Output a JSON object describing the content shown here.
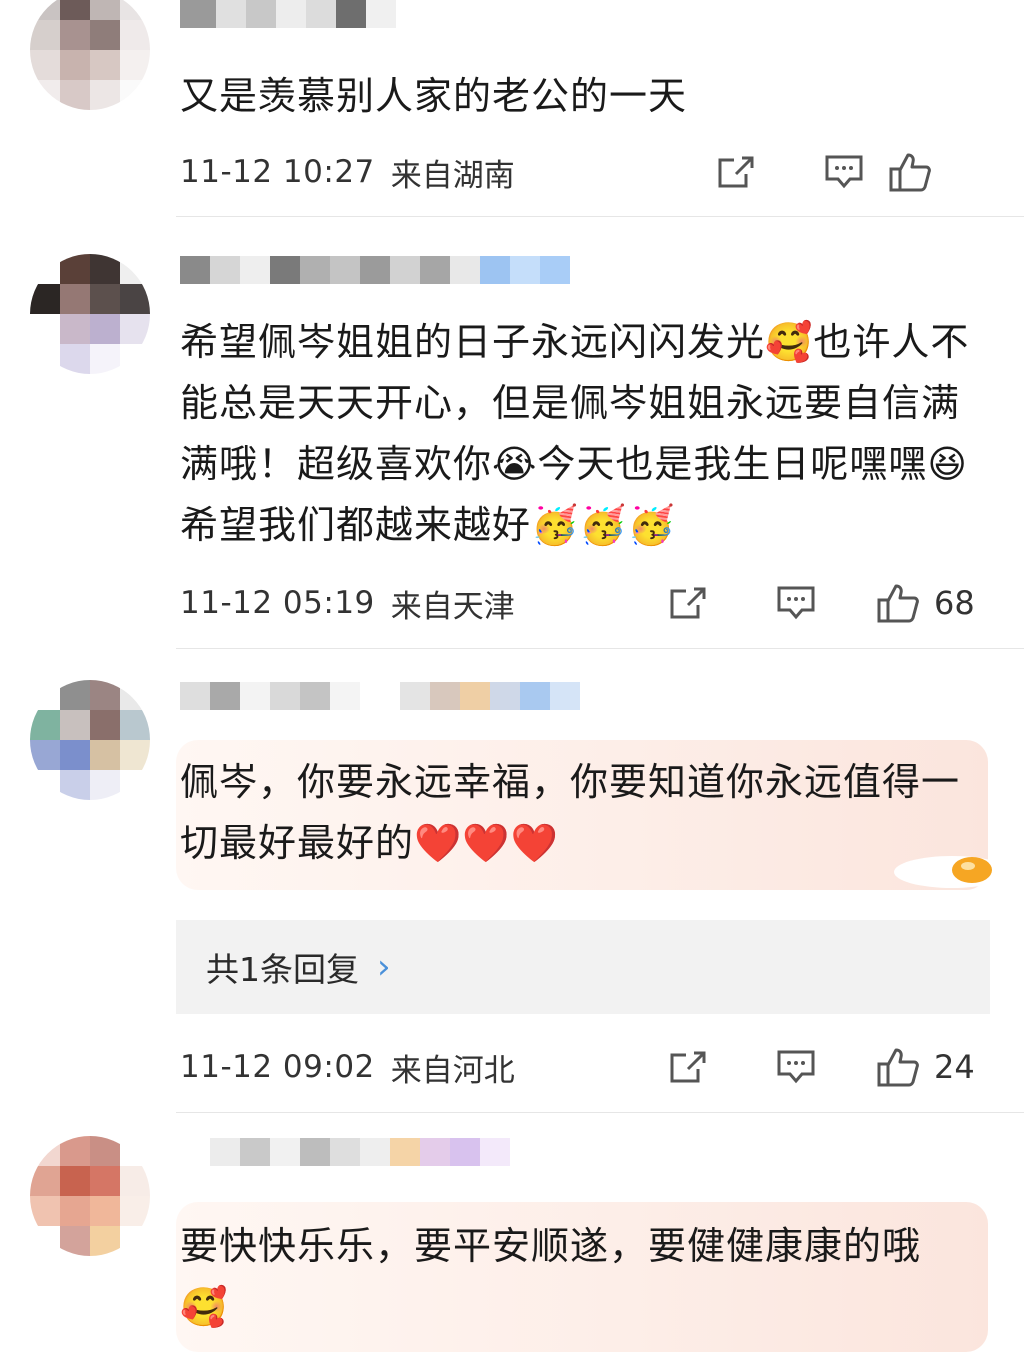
{
  "comments": [
    {
      "text": "又是羡慕别人家的老公的一天",
      "time": "11-12 10:27",
      "location": "来自湖南",
      "likes": ""
    },
    {
      "text": "希望佩岑姐姐的日子永远闪闪发光🥰也许人不能总是天天开心，但是佩岑姐姐永远要自信满满哦！超级喜欢你😭今天也是我生日呢嘿嘿😆希望我们都越来越好🥳🥳🥳",
      "time": "11-12 05:19",
      "location": "来自天津",
      "likes": "68"
    },
    {
      "text": "佩岑，你要永远幸福，你要知道你永远值得一切最好最好的❤️❤️❤️",
      "replies_label": "共1条回复",
      "time": "11-12 09:02",
      "location": "来自河北",
      "likes": "24"
    },
    {
      "text": "要快快乐乐，要平安顺遂，要健健康康的哦🥰"
    }
  ],
  "icons": {
    "repost": "share-icon",
    "comment": "comment-icon",
    "like": "thumbs-up-icon"
  },
  "colors": {
    "bubble": "#fdeee8",
    "reply_bg": "#f2f2f2",
    "reply_chevron": "#4a90d9",
    "divider": "#e6e6e6"
  }
}
